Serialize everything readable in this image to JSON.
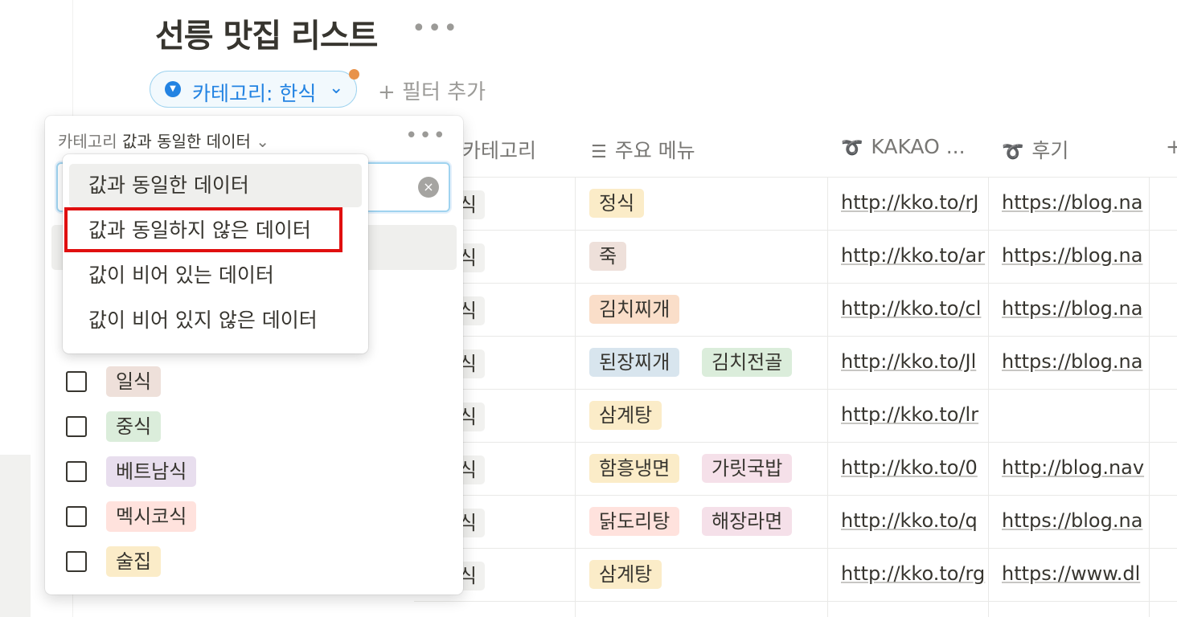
{
  "page": {
    "title": "선릉 맛집 리스트",
    "more": "•••"
  },
  "filter_chip": {
    "label": "카테고리: 한식",
    "chevron": "⌄",
    "icon": "filter-icon"
  },
  "add_filter": "+ 필터 추가",
  "columns": [
    {
      "icon": "",
      "label": "카테고리"
    },
    {
      "icon": "☰",
      "label": "주요 메뉴"
    },
    {
      "icon": "➰",
      "label": "KAKAO ..."
    },
    {
      "icon": "➰",
      "label": "후기"
    },
    {
      "icon": "",
      "label": "+"
    }
  ],
  "rows": [
    {
      "cat": "식",
      "menus": [
        {
          "t": "정식",
          "c": "#fbecc8"
        }
      ],
      "kakao": "http://kko.to/rJ",
      "review": "https://blog.na"
    },
    {
      "cat": "식",
      "menus": [
        {
          "t": "죽",
          "c": "#eee0da"
        }
      ],
      "kakao": "http://kko.to/ar",
      "review": "https://blog.na"
    },
    {
      "cat": "식",
      "menus": [
        {
          "t": "김치찌개",
          "c": "#fadec9"
        }
      ],
      "kakao": "http://kko.to/cl",
      "review": "https://blog.na"
    },
    {
      "cat": "식",
      "menus": [
        {
          "t": "된장찌개",
          "c": "#d8e5ee"
        },
        {
          "t": "김치전골",
          "c": "#dbeddb"
        }
      ],
      "kakao": "http://kko.to/Jl",
      "review": "https://blog.na"
    },
    {
      "cat": "식",
      "menus": [
        {
          "t": "삼계탕",
          "c": "#fbecc8"
        }
      ],
      "kakao": "http://kko.to/lr",
      "review": ""
    },
    {
      "cat": "식",
      "menus": [
        {
          "t": "함흥냉면",
          "c": "#fbecc8"
        },
        {
          "t": "가릿국밥",
          "c": "#f5e0e9"
        }
      ],
      "kakao": "http://kko.to/0",
      "review": "http://blog.nav"
    },
    {
      "cat": "식",
      "menus": [
        {
          "t": "닭도리탕",
          "c": "#ffe2dd"
        },
        {
          "t": "해장라면",
          "c": "#f5e0e9"
        }
      ],
      "kakao": "http://kko.to/q",
      "review": "https://blog.na"
    },
    {
      "cat": "식",
      "menus": [
        {
          "t": "삼계탕",
          "c": "#fbecc8"
        }
      ],
      "kakao": "http://kko.to/rg",
      "review": "https://www.dl"
    }
  ],
  "popover": {
    "header_prop": "카테고리",
    "header_cond": "값과 동일한 데이터",
    "header_chevron": "⌄",
    "more": "•••",
    "clear_icon": "×",
    "options": [
      {
        "label": "일식",
        "color": "#eee0da",
        "checked": false
      },
      {
        "label": "중식",
        "color": "#dbeddb",
        "checked": false
      },
      {
        "label": "베트남식",
        "color": "#e8deee",
        "checked": false
      },
      {
        "label": "멕시코식",
        "color": "#ffe2dd",
        "checked": false
      },
      {
        "label": "술집",
        "color": "#fbecc8",
        "checked": false
      }
    ]
  },
  "condition_menu": {
    "items": [
      "값과 동일한 데이터",
      "값과 동일하지 않은 데이터",
      "값이 비어 있는 데이터",
      "값이 비어 있지 않은 데이터"
    ],
    "selected_index": 0,
    "highlighted_index": 1
  }
}
